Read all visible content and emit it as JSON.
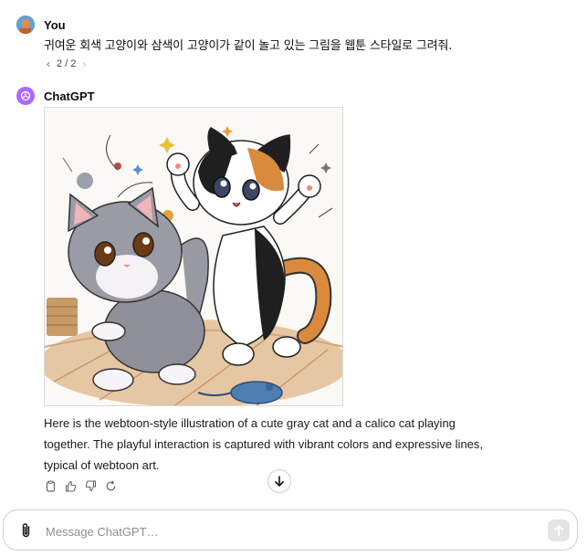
{
  "conversation": {
    "user": {
      "name": "You",
      "message": "귀여운 회색 고양이와 삼색이 고양이가 같이 놀고 있는 그림을 웹툰 스타일로 그려줘.",
      "pager": "2 / 2"
    },
    "assistant": {
      "name": "ChatGPT",
      "image_icon": "generated-illustration-two-cats",
      "response": "Here is the webtoon-style illustration of a cute gray cat and a calico cat playing together. The playful interaction is captured with vibrant colors and expressive lines, typical of webtoon art."
    },
    "actions": [
      "copy-icon",
      "thumbs-up-icon",
      "thumbs-down-icon",
      "regenerate-icon"
    ]
  },
  "composer": {
    "placeholder": "Message ChatGPT…"
  },
  "colors": {
    "assistant_avatar": "#ab68ff",
    "user_avatar": "#d9773a"
  }
}
